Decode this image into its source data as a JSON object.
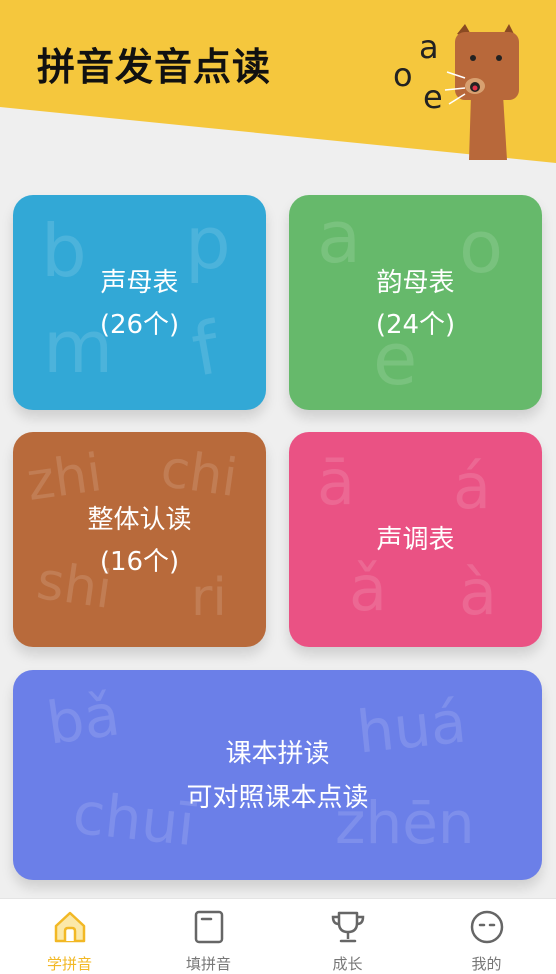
{
  "header": {
    "title": "拼音发音点读",
    "mascot_letters": [
      "a",
      "o",
      "e"
    ]
  },
  "cards": {
    "shengmu": {
      "title": "声母表",
      "count": "(26个)",
      "bg_letters": [
        "b",
        "p",
        "m",
        "f"
      ]
    },
    "yunmu": {
      "title": "韵母表",
      "count": "(24个)",
      "bg_letters": [
        "a",
        "o",
        "e"
      ]
    },
    "zhengti": {
      "title": "整体认读",
      "count": "(16个)",
      "bg_letters": [
        "zhi",
        "chi",
        "shi",
        "ri"
      ]
    },
    "shengdiao": {
      "title": "声调表",
      "bg_letters": [
        "ā",
        "á",
        "ǎ",
        "à"
      ]
    },
    "keben": {
      "title": "课本拼读",
      "subtitle": "可对照课本点读",
      "bg_letters": [
        "bǎ",
        "huá",
        "chuī",
        "zhēn"
      ]
    }
  },
  "nav": {
    "items": [
      {
        "label": "学拼音",
        "icon": "home-icon",
        "active": true
      },
      {
        "label": "填拼音",
        "icon": "notebook-icon",
        "active": false
      },
      {
        "label": "成长",
        "icon": "trophy-icon",
        "active": false
      },
      {
        "label": "我的",
        "icon": "face-icon",
        "active": false
      }
    ]
  },
  "colors": {
    "header_yellow": "#f5c73d",
    "shengmu": "#32a8d6",
    "yunmu": "#66b96b",
    "zhengti": "#b86a3b",
    "shengdiao": "#ea5284",
    "keben": "#6b7fe8",
    "nav_active": "#f2b825"
  }
}
